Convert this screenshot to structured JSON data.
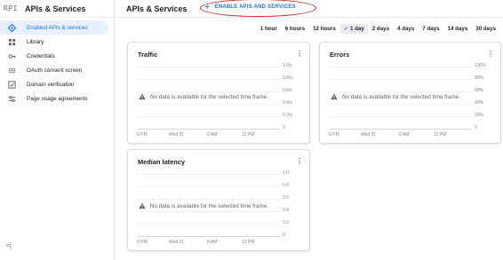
{
  "sidebar": {
    "logo": "RPI",
    "title": "APIs & Services",
    "items": [
      {
        "label": "Enabled APIs & services",
        "icon": "diamond-icon",
        "active": true
      },
      {
        "label": "Library",
        "icon": "grid-icon",
        "active": false
      },
      {
        "label": "Credentials",
        "icon": "key-icon",
        "active": false
      },
      {
        "label": "OAuth consent screen",
        "icon": "dots-icon",
        "active": false
      },
      {
        "label": "Domain verification",
        "icon": "checkbox-icon",
        "active": false
      },
      {
        "label": "Page usage agreements",
        "icon": "settings-list-icon",
        "active": false
      }
    ],
    "collapse_label": "<|"
  },
  "header": {
    "title": "APIs & Services",
    "enable_button": "ENABLE APIS AND SERVICES",
    "enable_icon": "+"
  },
  "time_range": {
    "options": [
      "1 hour",
      "6 hours",
      "12 hours",
      "1 day",
      "2 days",
      "4 days",
      "7 days",
      "14 days",
      "30 days"
    ],
    "selected": "1 day",
    "check": "✓"
  },
  "cards": {
    "traffic": {
      "title": "Traffic",
      "y_ticks": [
        "1.0/s",
        "0.8/s",
        "0.6/s",
        "0.4/s",
        "0.2/s",
        "0"
      ],
      "x_ticks": [
        "6 PM",
        "Wed 31",
        "6 AM",
        "12 PM"
      ],
      "no_data": "No data is available for the selected time frame."
    },
    "errors": {
      "title": "Errors",
      "y_ticks": [
        "100%",
        "80%",
        "60%",
        "40%",
        "20%",
        "0"
      ],
      "x_ticks": [
        "6 PM",
        "Wed 31",
        "6 AM",
        "12 PM"
      ],
      "no_data": "No data is available for the selected time frame."
    },
    "latency": {
      "title": "Median latency",
      "y_ticks": [
        "1.0",
        "0.8",
        "0.6",
        "0.4",
        "0.2",
        "0"
      ],
      "x_ticks": [
        "6 PM",
        "Wed 31",
        "6 AM",
        "12 PM"
      ],
      "no_data": "No data is available for the selected time frame."
    }
  },
  "colors": {
    "accent": "#1a73e8",
    "active_bg": "#e8f0fe",
    "annotation": "#c62828"
  }
}
